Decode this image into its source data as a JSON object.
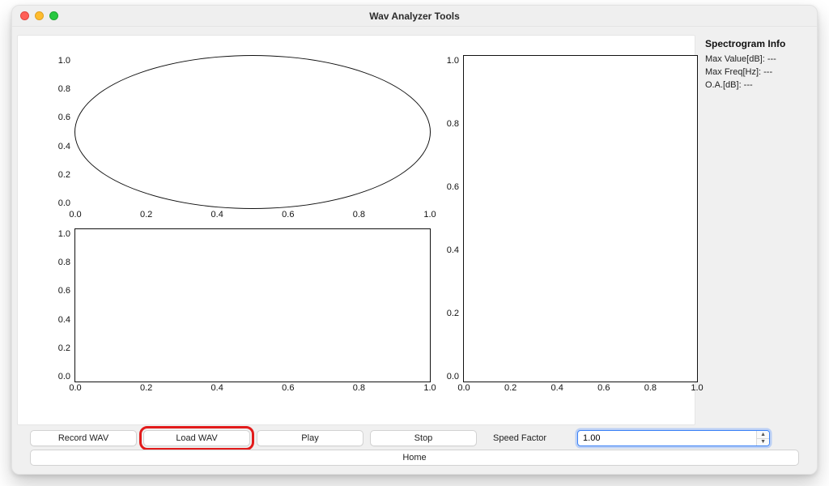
{
  "window": {
    "title": "Wav Analyzer Tools"
  },
  "info": {
    "heading": "Spectrogram Info",
    "max_value_label": "Max Value[dB]: ---",
    "max_freq_label": "Max Freq[Hz]: ---",
    "oa_label": "O.A.[dB]: ---"
  },
  "controls": {
    "record": "Record WAV",
    "load": "Load WAV",
    "play": "Play",
    "stop": "Stop",
    "speed_label": "Speed Factor",
    "speed_value": "1.00",
    "home": "Home",
    "highlighted": "load"
  },
  "chart_data": [
    {
      "id": "top_left",
      "type": "line",
      "title": "",
      "xlabel": "",
      "ylabel": "",
      "xlim": [
        0.0,
        1.0
      ],
      "ylim": [
        0.0,
        1.0
      ],
      "xticks": [
        0.0,
        0.2,
        0.4,
        0.6,
        0.8,
        1.0
      ],
      "yticks": [
        0.0,
        0.2,
        0.4,
        0.6,
        0.8,
        1.0
      ],
      "series": []
    },
    {
      "id": "bottom_left",
      "type": "line",
      "title": "",
      "xlabel": "",
      "ylabel": "",
      "xlim": [
        0.0,
        1.0
      ],
      "ylim": [
        0.0,
        1.0
      ],
      "xticks": [
        0.0,
        0.2,
        0.4,
        0.6,
        0.8,
        1.0
      ],
      "yticks": [
        0.0,
        0.2,
        0.4,
        0.6,
        0.8,
        1.0
      ],
      "series": []
    },
    {
      "id": "right_tall",
      "type": "line",
      "title": "",
      "xlabel": "",
      "ylabel": "",
      "xlim": [
        0.0,
        1.0
      ],
      "ylim": [
        0.0,
        1.0
      ],
      "xticks": [
        0.0,
        0.2,
        0.4,
        0.6,
        0.8,
        1.0
      ],
      "yticks": [
        0.0,
        0.2,
        0.4,
        0.6,
        0.8,
        1.0
      ],
      "series": []
    }
  ]
}
